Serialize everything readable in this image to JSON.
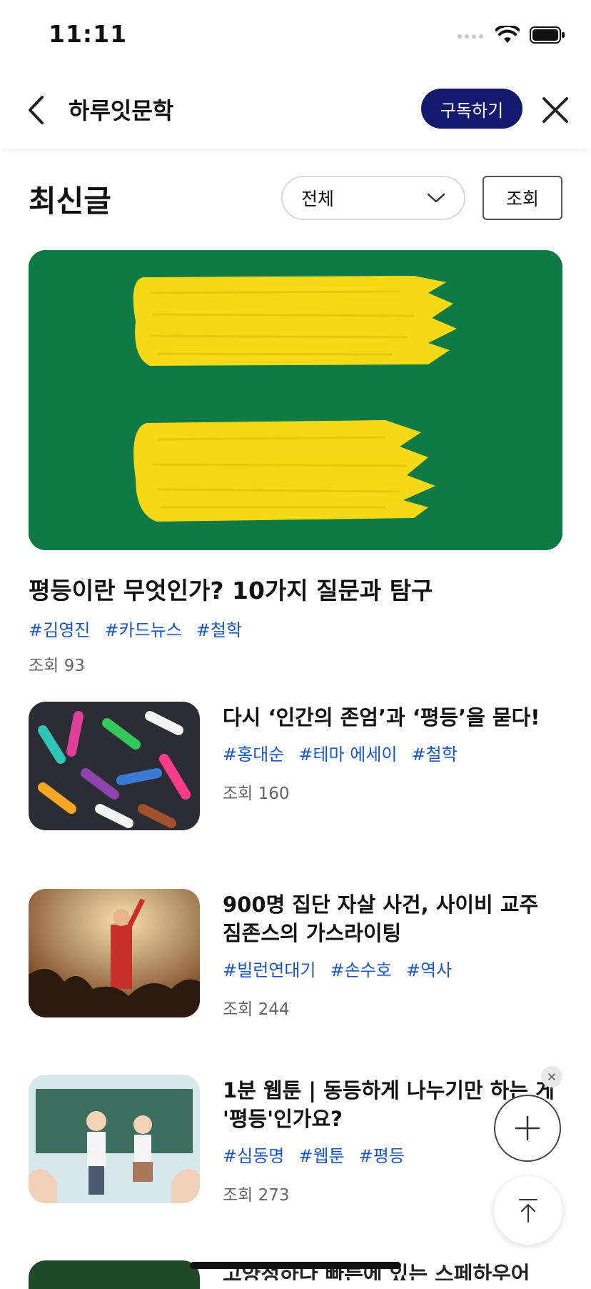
{
  "status_bar": {
    "time": "11:11"
  },
  "header": {
    "title": "하루잇문학",
    "subscribe_label": "구독하기"
  },
  "section": {
    "title": "최신글",
    "filter_value": "전체",
    "sort_label": "조회"
  },
  "featured": {
    "title": "평등이란 무엇인가? 10가지 질문과 탐구",
    "tags": [
      "#김영진",
      "#카드뉴스",
      "#철학"
    ],
    "views": "조회 93"
  },
  "articles": [
    {
      "title": "다시 ‘인간의 존엄’과 ‘평등’을 묻다!",
      "tags": [
        "#홍대순",
        "#테마 에세이",
        "#철학"
      ],
      "views": "조회 160"
    },
    {
      "title": "900명 집단 자살 사건, 사이비 교주 짐존스의 가스라이팅",
      "tags": [
        "#빌런연대기",
        "#손수호",
        "#역사"
      ],
      "views": "조회 244"
    },
    {
      "title": "1분 웹툰 | 동등하게 나누기만 하는 게 '평등'인가요?",
      "tags": [
        "#심동명",
        "#웹툰",
        "#평등"
      ],
      "views": "조회 273"
    }
  ],
  "next_preview": {
    "title": "고양정하다 빠른에 있는 스페하우어"
  },
  "colors": {
    "accent": "#121a6e",
    "tag": "#1a56c9",
    "feature_bg": "#0f7a45",
    "paint": "#f5d916"
  },
  "icons": [
    "back-icon",
    "close-icon",
    "chevron-down-icon",
    "plus-icon",
    "arrow-up-icon",
    "wifi-icon",
    "battery-icon",
    "signal-icon"
  ]
}
